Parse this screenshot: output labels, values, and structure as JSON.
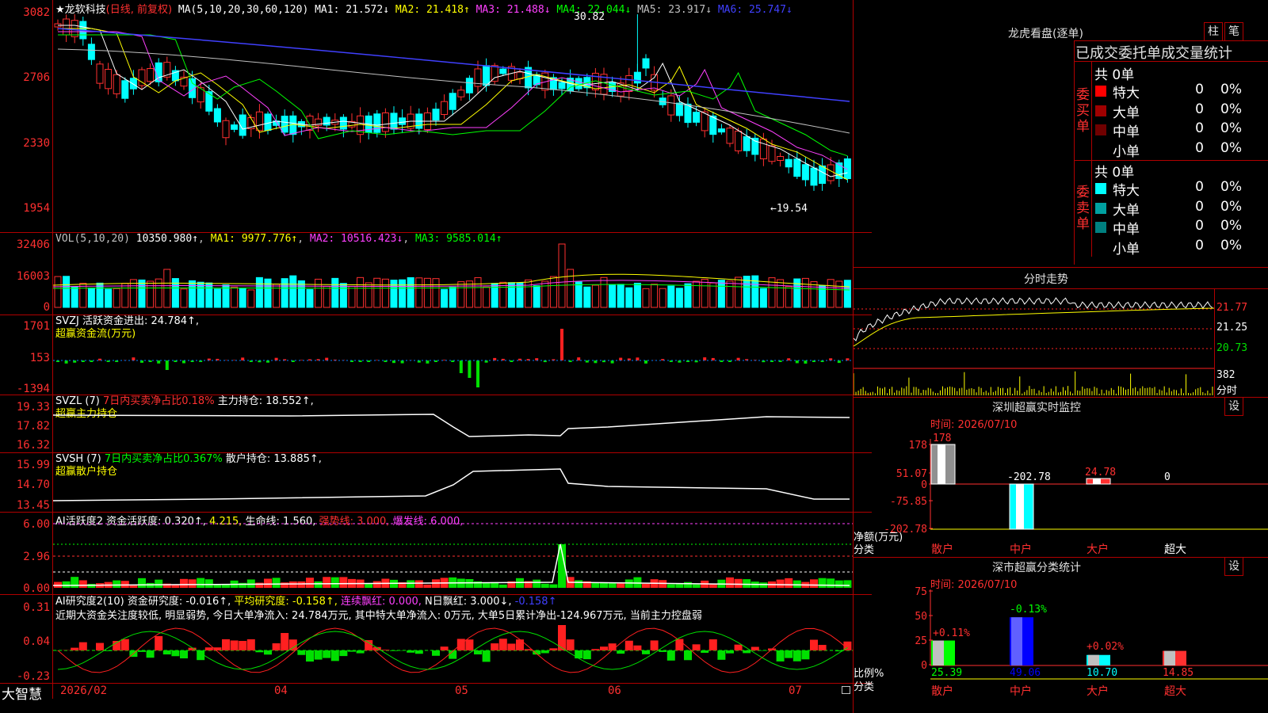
{
  "stock": {
    "title": "★龙软科技",
    "mode": "(日线, 前复权)"
  },
  "ma_legend": {
    "label": "MA(5,10,20,30,60,120)",
    "items": [
      {
        "text": "MA1: 21.572↓",
        "color": "#ffffff"
      },
      {
        "text": "MA2: 21.418↑",
        "color": "#ffff00"
      },
      {
        "text": "MA3: 21.488↓",
        "color": "#ff40ff"
      },
      {
        "text": "MA4: 22.044↓",
        "color": "#00ff00"
      },
      {
        "text": "MA5: 23.917↓",
        "color": "#c0c0c0"
      },
      {
        "text": "MA6: 25.747↓",
        "color": "#4040ff"
      }
    ]
  },
  "main_axis": [
    "3082",
    "2706",
    "2330",
    "1954"
  ],
  "high_mark": "30.82",
  "low_mark": "←19.54",
  "vol_legend": {
    "label": "VOL(5,10,20)",
    "value": "10350.980↑",
    "ma1": "MA1: 9977.776↑",
    "ma2": "MA2: 10516.423↓",
    "ma3": "MA3: 9585.014↑"
  },
  "vol_axis": [
    "32406",
    "16003",
    "0"
  ],
  "svzj": {
    "line1": "SVZJ  活跃资金进出: 24.784↑,",
    "line2": "超赢资金流(万元)",
    "axis": [
      "1701",
      "153",
      "-1394"
    ]
  },
  "svzl": {
    "head": "SVZL (7)",
    "mid": "7日内买卖净占比0.18%",
    "tail": "主力持仓: 18.552↑,",
    "line2": "超赢主力持仓",
    "axis": [
      "19.33",
      "17.82",
      "16.32"
    ]
  },
  "svsh": {
    "head": "SVSH (7)",
    "mid": "7日内买卖净占比0.367%",
    "tail": "散户持仓: 13.885↑,",
    "line2": "超赢散户持仓",
    "axis": [
      "15.99",
      "14.70",
      "13.45"
    ]
  },
  "ai_active": {
    "head": "AI活跃度2",
    "a": "资金活跃度: 0.320↑,",
    "b": "4.215,",
    "c": "生命线: 1.560,",
    "d": "强势线: 3.000,",
    "e": "爆发线: 6.000,",
    "axis": [
      "6.00",
      "2.96",
      "0.00"
    ]
  },
  "ai_research": {
    "head": "AI研究度2(10)",
    "a": "资金研究度: -0.016↑,",
    "b": "平均研究度: -0.158↑,",
    "c": "连续飘红: 0.000,",
    "d": "N日飘红: 3.000↓,",
    "e": "-0.158↑",
    "comment": "近期大资金关注度较低, 明显弱势, 今日大单净流入: 24.784万元, 其中特大单净流入: 0万元, 大单5日累计净出-124.967万元, 当前主力控盘弱",
    "axis": [
      "0.31",
      "0.04",
      "-0.23"
    ]
  },
  "x_axis": [
    "2026/02",
    "04",
    "05",
    "06",
    "07"
  ],
  "brand": "大智慧",
  "right": {
    "dragon_title": "龙虎看盘(逐单)",
    "btn_bar": "柱",
    "btn_pen": "笔",
    "tabs": "已成交委托单成交量统计",
    "buy": {
      "label": "委买单",
      "total": "共 0单",
      "rows": [
        {
          "name": "特大",
          "count": "0",
          "pct": "0%",
          "color": "#ff0000"
        },
        {
          "name": "大单",
          "count": "0",
          "pct": "0%",
          "color": "#a00000"
        },
        {
          "name": "中单",
          "count": "0",
          "pct": "0%",
          "color": "#700000"
        },
        {
          "name": "小单",
          "count": "0",
          "pct": "0%",
          "color": "#000000"
        }
      ]
    },
    "sell": {
      "label": "委卖单",
      "total": "共 0单",
      "rows": [
        {
          "name": "特大",
          "count": "0",
          "pct": "0%",
          "color": "#00ffff"
        },
        {
          "name": "大单",
          "count": "0",
          "pct": "0%",
          "color": "#00a0a0"
        },
        {
          "name": "中单",
          "count": "0",
          "pct": "0%",
          "color": "#008080"
        },
        {
          "name": "小单",
          "count": "0",
          "pct": "0%",
          "color": "#000000"
        }
      ]
    },
    "intraday_title": "分时走势",
    "intraday_axis": [
      "21.77",
      "21.25",
      "20.73",
      "382",
      "分时"
    ],
    "monitor_title": "深圳超赢实时监控",
    "monitor_btn": "设",
    "monitor_time": "时间: 2026/07/10",
    "monitor_axis": [
      "178",
      "51.07",
      "0",
      "-75.85",
      "-202.78"
    ],
    "monitor_vals": [
      "178",
      "-202.78",
      "24.78",
      "0"
    ],
    "monitor_ylabel": "净额(万元)",
    "monitor_xlabel": "分类",
    "cats": [
      "散户",
      "中户",
      "大户",
      "超大"
    ],
    "stats_title": "深市超赢分类统计",
    "stats_btn": "设",
    "stats_time": "时间: 2026/07/10",
    "stats_axis": [
      "75",
      "50",
      "25",
      "0"
    ],
    "stats_top": [
      "+0.11%",
      "-0.13%",
      "+0.02%",
      ""
    ],
    "stats_vals": [
      "25.39",
      "49.06",
      "10.70",
      "14.85"
    ],
    "stats_ylabel": "比例%",
    "stats_xlabel": "分类"
  }
}
